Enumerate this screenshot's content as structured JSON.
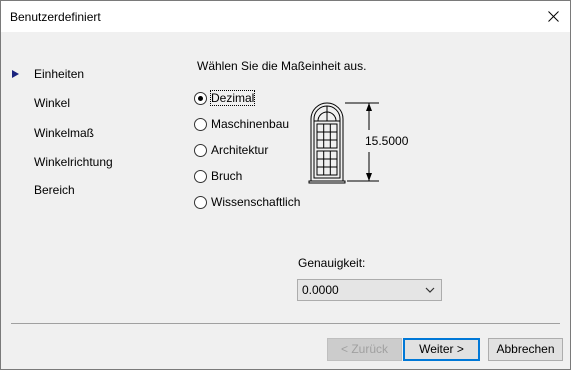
{
  "window": {
    "title": "Benutzerdefiniert"
  },
  "nav": {
    "items": [
      {
        "label": "Einheiten",
        "active": true
      },
      {
        "label": "Winkel",
        "active": false
      },
      {
        "label": "Winkelmaß",
        "active": false
      },
      {
        "label": "Winkelrichtung",
        "active": false
      },
      {
        "label": "Bereich",
        "active": false
      }
    ]
  },
  "units": {
    "prompt": "Wählen Sie die Maßeinheit aus.",
    "options": [
      {
        "label": "Dezimal",
        "checked": true
      },
      {
        "label": "Maschinenbau",
        "checked": false
      },
      {
        "label": "Architektur",
        "checked": false
      },
      {
        "label": "Bruch",
        "checked": false
      },
      {
        "label": "Wissenschaftlich",
        "checked": false
      }
    ],
    "preview_dimension": "15.5000"
  },
  "precision": {
    "label": "Genauigkeit:",
    "value": "0.0000"
  },
  "buttons": {
    "back": "< Zurück",
    "next": "Weiter >",
    "cancel": "Abbrechen"
  },
  "colors": {
    "window_bg": "#f0f0f0",
    "titlebar_bg": "#ffffff",
    "nav_arrow": "#1a237e",
    "default_button_border": "#0078d7"
  }
}
